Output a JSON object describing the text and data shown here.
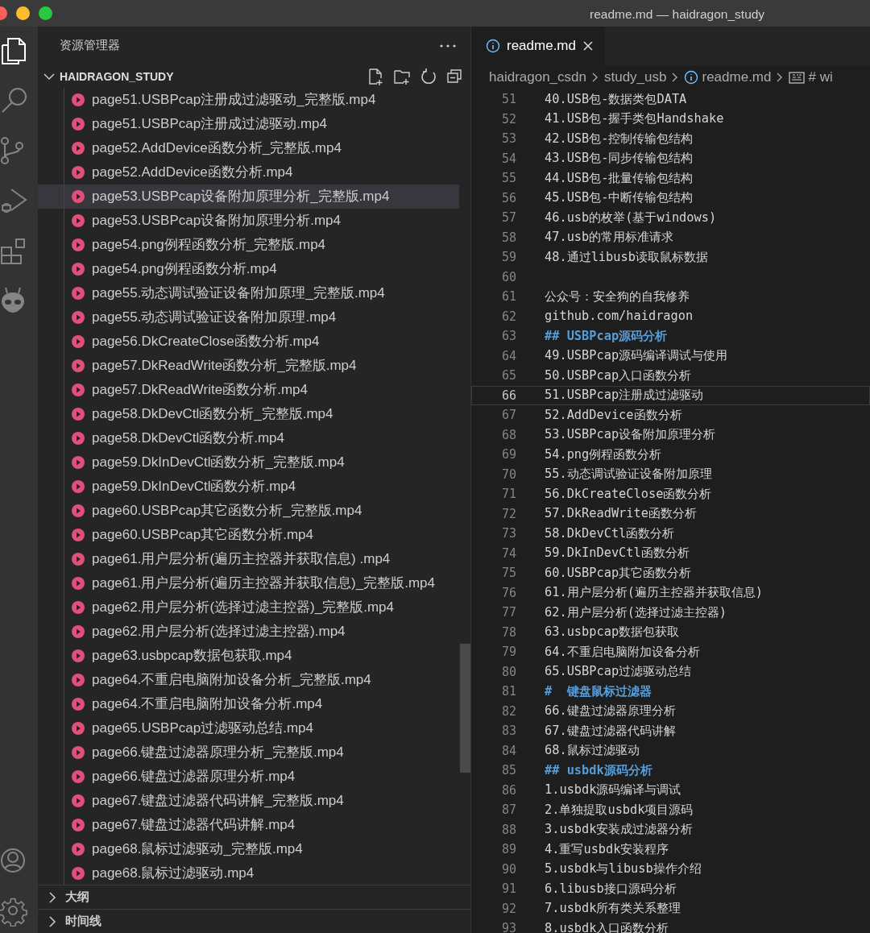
{
  "window": {
    "title": "readme.md — haidragon_study"
  },
  "activity_bar": {
    "items": [
      {
        "kind": "files",
        "selected": true
      },
      {
        "kind": "search",
        "selected": false
      },
      {
        "kind": "branch",
        "selected": false
      },
      {
        "kind": "debug",
        "selected": false
      },
      {
        "kind": "blocks",
        "selected": false
      },
      {
        "kind": "alien",
        "selected": false
      }
    ],
    "bottom": [
      {
        "kind": "account"
      },
      {
        "kind": "gear"
      }
    ]
  },
  "sidebar": {
    "title": "资源管理器",
    "folder": {
      "label": "HAIDRAGON_STUDY",
      "expanded": true
    },
    "files": [
      {
        "label": "page51.USBPcap注册成过滤驱动_完整版.mp4",
        "selected": false
      },
      {
        "label": "page51.USBPcap注册成过滤驱动.mp4",
        "selected": false
      },
      {
        "label": "page52.AddDevice函数分析_完整版.mp4",
        "selected": false
      },
      {
        "label": "page52.AddDevice函数分析.mp4",
        "selected": false
      },
      {
        "label": "page53.USBPcap设备附加原理分析_完整版.mp4",
        "selected": true
      },
      {
        "label": "page53.USBPcap设备附加原理分析.mp4",
        "selected": false
      },
      {
        "label": "page54.png例程函数分析_完整版.mp4",
        "selected": false
      },
      {
        "label": "page54.png例程函数分析.mp4",
        "selected": false
      },
      {
        "label": "page55.动态调试验证设备附加原理_完整版.mp4",
        "selected": false
      },
      {
        "label": "page55.动态调试验证设备附加原理.mp4",
        "selected": false
      },
      {
        "label": "page56.DkCreateClose函数分析.mp4",
        "selected": false
      },
      {
        "label": "page57.DkReadWrite函数分析_完整版.mp4",
        "selected": false
      },
      {
        "label": "page57.DkReadWrite函数分析.mp4",
        "selected": false
      },
      {
        "label": "page58.DkDevCtl函数分析_完整版.mp4",
        "selected": false
      },
      {
        "label": "page58.DkDevCtl函数分析.mp4",
        "selected": false
      },
      {
        "label": "page59.DkInDevCtl函数分析_完整版.mp4",
        "selected": false
      },
      {
        "label": "page59.DkInDevCtl函数分析.mp4",
        "selected": false
      },
      {
        "label": "page60.USBPcap其它函数分析_完整版.mp4",
        "selected": false
      },
      {
        "label": "page60.USBPcap其它函数分析.mp4",
        "selected": false
      },
      {
        "label": "page61.用户层分析(遍历主控器并获取信息) .mp4",
        "selected": false
      },
      {
        "label": "page61.用户层分析(遍历主控器并获取信息)_完整版.mp4",
        "selected": false
      },
      {
        "label": "page62.用户层分析(选择过滤主控器)_完整版.mp4",
        "selected": false
      },
      {
        "label": "page62.用户层分析(选择过滤主控器).mp4",
        "selected": false
      },
      {
        "label": "page63.usbpcap数据包获取.mp4",
        "selected": false
      },
      {
        "label": "page64.不重启电脑附加设备分析_完整版.mp4",
        "selected": false
      },
      {
        "label": "page64.不重启电脑附加设备分析.mp4",
        "selected": false
      },
      {
        "label": "page65.USBPcap过滤驱动总结.mp4",
        "selected": false
      },
      {
        "label": "page66.键盘过滤器原理分析_完整版.mp4",
        "selected": false
      },
      {
        "label": "page66.键盘过滤器原理分析.mp4",
        "selected": false
      },
      {
        "label": "page67.键盘过滤器代码讲解_完整版.mp4",
        "selected": false
      },
      {
        "label": "page67.键盘过滤器代码讲解.mp4",
        "selected": false
      },
      {
        "label": "page68.鼠标过滤驱动_完整版.mp4",
        "selected": false
      },
      {
        "label": "page68.鼠标过滤驱动.mp4",
        "selected": false
      }
    ],
    "sections": [
      {
        "label": "大纲",
        "expanded": false
      },
      {
        "label": "时间线",
        "expanded": false
      }
    ]
  },
  "editor": {
    "tabs": [
      {
        "label": "readme.md",
        "selected": true
      }
    ],
    "breadcrumbs": [
      {
        "label": "haidragon_csdn",
        "kind": "folder"
      },
      {
        "label": "study_usb",
        "kind": "folder"
      },
      {
        "label": "readme.md",
        "kind": "file"
      },
      {
        "label": "# wi",
        "kind": "symbol"
      }
    ],
    "lines": [
      {
        "number": "51",
        "text": "40.USB包-数据类包DATA",
        "kind": "text",
        "selected": false
      },
      {
        "number": "52",
        "text": "41.USB包-握手类包Handshake",
        "kind": "text",
        "selected": false
      },
      {
        "number": "53",
        "text": "42.USB包-控制传输包结构",
        "kind": "text",
        "selected": false
      },
      {
        "number": "54",
        "text": "43.USB包-同步传输包结构",
        "kind": "text",
        "selected": false
      },
      {
        "number": "55",
        "text": "44.USB包-批量传输包结构",
        "kind": "text",
        "selected": false
      },
      {
        "number": "56",
        "text": "45.USB包-中断传输包结构",
        "kind": "text",
        "selected": false
      },
      {
        "number": "57",
        "text": "46.usb的枚举(基于windows)",
        "kind": "text",
        "selected": false
      },
      {
        "number": "58",
        "text": "47.usb的常用标准请求",
        "kind": "text",
        "selected": false
      },
      {
        "number": "59",
        "text": "48.通过libusb读取鼠标数据",
        "kind": "text",
        "selected": false
      },
      {
        "number": "60",
        "selected": false
      },
      {
        "number": "61",
        "text": "公众号：安全狗的自我修养",
        "kind": "text",
        "selected": false
      },
      {
        "number": "62",
        "text": "github.com/haidragon",
        "kind": "text",
        "selected": false
      },
      {
        "number": "63",
        "text": "## USBPcap源码分析",
        "kind": "heading",
        "selected": false
      },
      {
        "number": "64",
        "text": "49.USBPcap源码编译调试与使用",
        "kind": "text",
        "selected": false
      },
      {
        "number": "65",
        "text": "50.USBPcap入口函数分析",
        "kind": "text",
        "selected": false
      },
      {
        "number": "66",
        "text": "51.USBPcap注册成过滤驱动",
        "kind": "text",
        "selected": true
      },
      {
        "number": "67",
        "text": "52.AddDevice函数分析",
        "kind": "text",
        "selected": false
      },
      {
        "number": "68",
        "text": "53.USBPcap设备附加原理分析",
        "kind": "text",
        "selected": false
      },
      {
        "number": "69",
        "text": "54.png例程函数分析",
        "kind": "text",
        "selected": false
      },
      {
        "number": "70",
        "text": "55.动态调试验证设备附加原理",
        "kind": "text",
        "selected": false
      },
      {
        "number": "71",
        "text": "56.DkCreateClose函数分析",
        "kind": "text",
        "selected": false
      },
      {
        "number": "72",
        "text": "57.DkReadWrite函数分析",
        "kind": "text",
        "selected": false
      },
      {
        "number": "73",
        "text": "58.DkDevCtl函数分析",
        "kind": "text",
        "selected": false
      },
      {
        "number": "74",
        "text": "59.DkInDevCtl函数分析",
        "kind": "text",
        "selected": false
      },
      {
        "number": "75",
        "text": "60.USBPcap其它函数分析",
        "kind": "text",
        "selected": false
      },
      {
        "number": "76",
        "text": "61.用户层分析(遍历主控器并获取信息)",
        "kind": "text",
        "selected": false
      },
      {
        "number": "77",
        "text": "62.用户层分析(选择过滤主控器)",
        "kind": "text",
        "selected": false
      },
      {
        "number": "78",
        "text": "63.usbpcap数据包获取",
        "kind": "text",
        "selected": false
      },
      {
        "number": "79",
        "text": "64.不重启电脑附加设备分析",
        "kind": "text",
        "selected": false
      },
      {
        "number": "80",
        "text": "65.USBPcap过滤驱动总结",
        "kind": "text",
        "selected": false
      },
      {
        "number": "81",
        "text": "#  键盘鼠标过滤器",
        "kind": "heading",
        "selected": false
      },
      {
        "number": "82",
        "text": "66.键盘过滤器原理分析",
        "kind": "text",
        "selected": false
      },
      {
        "number": "83",
        "text": "67.键盘过滤器代码讲解",
        "kind": "text",
        "selected": false
      },
      {
        "number": "84",
        "text": "68.鼠标过滤驱动",
        "kind": "text",
        "selected": false
      },
      {
        "number": "85",
        "text": "## usbdk源码分析",
        "kind": "heading",
        "selected": false
      },
      {
        "number": "86",
        "text": "1.usbdk源码编译与调试",
        "kind": "text",
        "selected": false
      },
      {
        "number": "87",
        "text": "2.单独提取usbdk项目源码",
        "kind": "text",
        "selected": false
      },
      {
        "number": "88",
        "text": "3.usbdk安装成过滤器分析",
        "kind": "text",
        "selected": false
      },
      {
        "number": "89",
        "text": "4.重写usbdk安装程序",
        "kind": "text",
        "selected": false
      },
      {
        "number": "90",
        "text": "5.usbdk与libusb操作介绍",
        "kind": "text",
        "selected": false
      },
      {
        "number": "91",
        "text": "6.libusb接口源码分析",
        "kind": "text",
        "selected": false
      },
      {
        "number": "92",
        "text": "7.usbdk所有类关系整理",
        "kind": "text",
        "selected": false
      },
      {
        "number": "93",
        "text": "8.usbdk入口函数分析",
        "kind": "text",
        "selected": false
      }
    ]
  }
}
